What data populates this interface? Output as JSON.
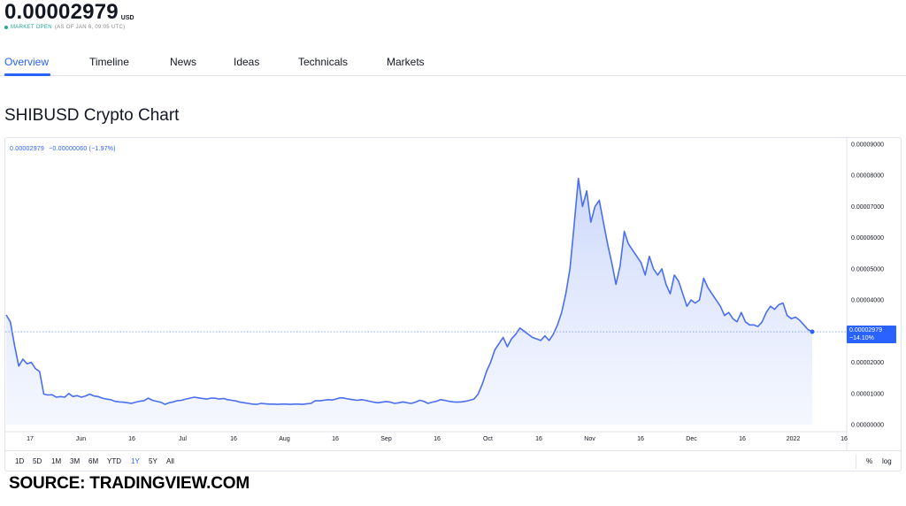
{
  "header": {
    "price": "0.00002979",
    "currency": "USD",
    "market_status": "MARKET OPEN",
    "as_of": "(AS OF JAN 6, 09:05 UTC)"
  },
  "tabs": [
    {
      "label": "Overview",
      "active": true
    },
    {
      "label": "Timeline",
      "active": false
    },
    {
      "label": "News",
      "active": false
    },
    {
      "label": "Ideas",
      "active": false
    },
    {
      "label": "Technicals",
      "active": false
    },
    {
      "label": "Markets",
      "active": false
    }
  ],
  "section_title": "SHIBUSD Crypto Chart",
  "legend": {
    "value": "0.00002979",
    "change": "−0.00000060 (−1.97%)"
  },
  "price_tag": {
    "value": "0.00002979",
    "change": "−14.10%"
  },
  "ranges": [
    {
      "label": "1D",
      "active": false
    },
    {
      "label": "5D",
      "active": false
    },
    {
      "label": "1M",
      "active": false
    },
    {
      "label": "3M",
      "active": false
    },
    {
      "label": "6M",
      "active": false
    },
    {
      "label": "YTD",
      "active": false
    },
    {
      "label": "1Y",
      "active": true
    },
    {
      "label": "5Y",
      "active": false
    },
    {
      "label": "All",
      "active": false
    }
  ],
  "scale_options": [
    "%",
    "log"
  ],
  "source": "SOURCE: TRADINGVIEW.COM",
  "colors": {
    "accent": "#2962ff",
    "market_open": "#26a69a",
    "line": "#4a6ef0",
    "area_top": "#c9d6fb"
  },
  "chart_data": {
    "type": "area",
    "series": [
      {
        "values": [
          3.52e-05,
          3.3e-05,
          2.55e-05,
          1.88e-05,
          2.1e-05,
          1.95e-05,
          2e-05,
          1.8e-05,
          1.7e-05,
          9.8e-06,
          9.5e-06,
          9.6e-06,
          8.8e-06,
          9e-06,
          8.8e-06,
          1e-05,
          9e-06,
          9.3e-06,
          8.8e-06,
          9.2e-06,
          9.8e-06,
          9.2e-06,
          9e-06,
          8.5e-06,
          8.2e-06,
          8e-06,
          7.5e-06,
          7.3e-06,
          7.2e-06,
          7e-06,
          6.8e-06,
          7.2e-06,
          7.5e-06,
          7.7e-06,
          8.5e-06,
          7.8e-06,
          7.5e-06,
          7.2e-06,
          6.5e-06,
          7e-06,
          7.3e-06,
          7.7e-06,
          7.8e-06,
          8.2e-06,
          8.5e-06,
          8.8e-06,
          8.6e-06,
          8.4e-06,
          8.2e-06,
          8.5e-06,
          8.5e-06,
          8.2e-06,
          8.4e-06,
          8e-06,
          7.8e-06,
          7.6e-06,
          7.2e-06,
          7e-06,
          6.8e-06,
          6.6e-06,
          6.5e-06,
          6.8e-06,
          6.7e-06,
          6.6e-06,
          6.6e-06,
          6.5e-06,
          6.6e-06,
          6.6e-06,
          6.5e-06,
          6.6e-06,
          6.6e-06,
          6.5e-06,
          6.7e-06,
          6.8e-06,
          7.7e-06,
          7.6e-06,
          7.8e-06,
          8e-06,
          7.9e-06,
          8.2e-06,
          8.6e-06,
          8.5e-06,
          8.2e-06,
          8e-06,
          7.8e-06,
          8e-06,
          7.8e-06,
          7.5e-06,
          7.2e-06,
          7e-06,
          7.2e-06,
          7.4e-06,
          7.2e-06,
          6.8e-06,
          7e-06,
          7.3e-06,
          7e-06,
          6.8e-06,
          7.2e-06,
          7.8e-06,
          7.5e-06,
          6.8e-06,
          7.2e-06,
          7.5e-06,
          8e-06,
          7.8e-06,
          7.5e-06,
          7.3e-06,
          7.2e-06,
          7.3e-06,
          7.5e-06,
          7.8e-06,
          8.2e-06,
          9.8e-06,
          1.3e-05,
          1.7e-05,
          2e-05,
          2.4e-05,
          2.6e-05,
          2.8e-05,
          2.5e-05,
          2.75e-05,
          2.9e-05,
          3.1e-05,
          3e-05,
          2.9e-05,
          2.8e-05,
          2.75e-05,
          2.7e-05,
          2.85e-05,
          2.7e-05,
          2.9e-05,
          3.2e-05,
          3.6e-05,
          4.2e-05,
          5e-05,
          6.4e-05,
          7.9e-05,
          7e-05,
          7.5e-05,
          6.5e-05,
          7e-05,
          7.2e-05,
          6.5e-05,
          5.8e-05,
          5.2e-05,
          4.5e-05,
          5.1e-05,
          6.2e-05,
          5.8e-05,
          5.6e-05,
          5.4e-05,
          5.2e-05,
          4.8e-05,
          5.4e-05,
          5e-05,
          4.8e-05,
          5e-05,
          4.5e-05,
          4.2e-05,
          4.8e-05,
          4.6e-05,
          4.2e-05,
          3.8e-05,
          4e-05,
          3.9e-05,
          4e-05,
          4.7e-05,
          4.4e-05,
          4.2e-05,
          4e-05,
          3.8e-05,
          3.5e-05,
          3.6e-05,
          3.4e-05,
          3.3e-05,
          3.6e-05,
          3.3e-05,
          3.2e-05,
          3.2e-05,
          3.15e-05,
          3.3e-05,
          3.6e-05,
          3.8e-05,
          3.7e-05,
          3.85e-05,
          3.9e-05,
          3.5e-05,
          3.4e-05,
          3.45e-05,
          3.35e-05,
          3.2e-05,
          3.05e-05,
          2.98e-05
        ]
      }
    ],
    "x_ticks": [
      "17",
      "Jun",
      "16",
      "Jul",
      "16",
      "Aug",
      "16",
      "Sep",
      "16",
      "Oct",
      "16",
      "Nov",
      "16",
      "Dec",
      "16",
      "2022",
      "16"
    ],
    "y_ticks": [
      "0.00009000",
      "0.00008000",
      "0.00007000",
      "0.00006000",
      "0.00005000",
      "0.00004000",
      "0.00003000",
      "0.00002000",
      "0.00001000",
      "0.00000000"
    ],
    "ylim": [
      0,
      9e-05
    ],
    "last_value": 2.979e-05,
    "grid": false
  }
}
